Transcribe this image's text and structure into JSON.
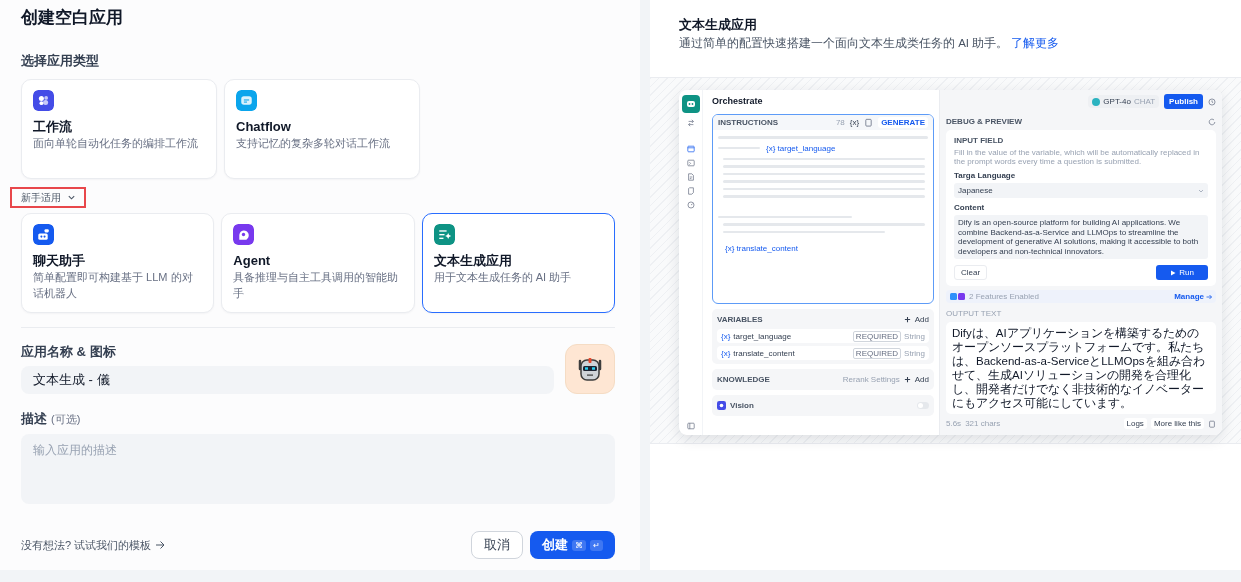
{
  "title": "创建空白应用",
  "type_label": "选择应用类型",
  "primary_types": [
    {
      "kind": "workflow",
      "name": "工作流",
      "description": "面向单轮自动化任务的编排工作流",
      "selected": false
    },
    {
      "kind": "chatflow",
      "name": "Chatflow",
      "description": "支持记忆的复杂多轮对话工作流",
      "selected": false
    }
  ],
  "beginner_toggle": {
    "label": "新手适用",
    "expanded": true
  },
  "beginner_types": [
    {
      "kind": "chatbot",
      "name": "聊天助手",
      "description": "简单配置即可构建基于 LLM 的对话机器人",
      "selected": false
    },
    {
      "kind": "agent",
      "name": "Agent",
      "description": "具备推理与自主工具调用的智能助手",
      "selected": false
    },
    {
      "kind": "completion",
      "name": "文本生成应用",
      "description": "用于文本生成任务的 AI 助手",
      "selected": true
    }
  ],
  "name_section": {
    "label": "应用名称 & 图标",
    "value": "文本生成 - 儀"
  },
  "description_section": {
    "label": "描述",
    "optional": "(可选)",
    "placeholder": "输入应用的描述"
  },
  "template_link": "没有想法? 试试我们的模板",
  "cancel_button": "取消",
  "create_button": {
    "label": "创建",
    "keys": [
      "⌘",
      "↵"
    ]
  },
  "preview": {
    "title": "文本生成应用",
    "description": "通过简单的配置快速搭建一个面向文本生成类任务的 AI 助手。",
    "link": "了解更多",
    "screenshot": {
      "header": "Orchestrate",
      "instructions": {
        "label": "INSTRUCTIONS",
        "count": "78",
        "variable_button": "{x}",
        "generate": "GENERATE",
        "tokens": [
          "{x} target_language",
          "{x} translate_content"
        ]
      },
      "variables": {
        "label": "VARIABLES",
        "add": "Add",
        "rows": [
          {
            "icon": "{x}",
            "name": "target_language",
            "required": "REQUIRED",
            "type": "String"
          },
          {
            "icon": "{x}",
            "name": "translate_content",
            "required": "REQUIRED",
            "type": "String"
          }
        ]
      },
      "knowledge": {
        "label": "KNOWLEDGE",
        "rerank": "Rerank Settings",
        "add": "Add"
      },
      "vision": {
        "label": "Vision",
        "on": false
      },
      "model": {
        "name": "GPT-4o",
        "mode": "CHAT"
      },
      "publish": "Publish",
      "debug": {
        "label": "DEBUG & PREVIEW",
        "input_label": "INPUT FIELD",
        "hint": "Fill in the value of the variable, which will be automatically replaced in the prompt words every time a question is submitted.",
        "fields": [
          {
            "kind": "select",
            "label": "Targa Language",
            "value": "Japanese"
          },
          {
            "kind": "textarea",
            "label": "Content",
            "value": "Dify is an open-source platform for building AI applications. We combine Backend-as-a-Service and LLMOps to streamline the development of generative AI solutions, making it accessible to both developers and non-technical innovators."
          }
        ],
        "clear": "Clear",
        "run": "Run",
        "features": "2 Features Enabled",
        "manage": "Manage"
      },
      "output": {
        "label": "OUTPUT TEXT",
        "text": "Difyは、AIアプリケーションを構築するためのオープンソースプラットフォームです。私たちは、Backend-as-a-ServiceとLLMOpsを組み合わせて、生成AIソリューションの開発を合理化し、開発者だけでなく非技術的なイノベーターにもアクセス可能にしています。",
        "time": "5.6s",
        "chars": "321 chars",
        "logs": "Logs",
        "more": "More like this"
      }
    }
  }
}
